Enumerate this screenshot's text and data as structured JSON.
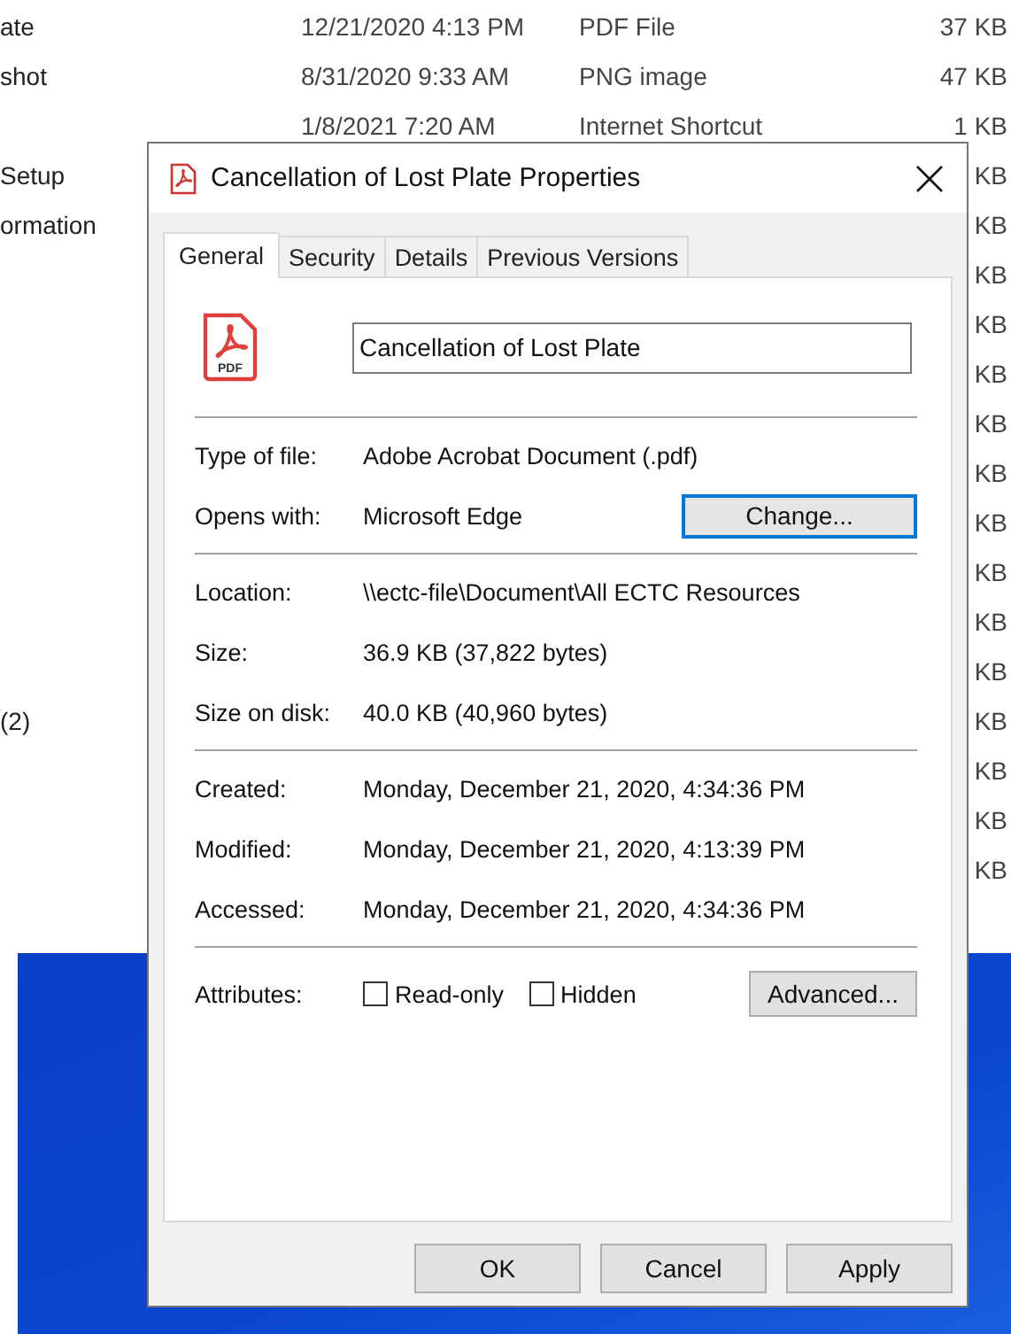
{
  "explorer": {
    "rows": [
      {
        "name": "ate",
        "date": "12/21/2020 4:13 PM",
        "type": "PDF File",
        "size": "37 KB"
      },
      {
        "name": "shot",
        "date": "8/31/2020 9:33 AM",
        "type": "PNG image",
        "size": "47 KB"
      },
      {
        "name": "",
        "date": "1/8/2021 7:20 AM",
        "type": "Internet Shortcut",
        "size": "1 KB"
      },
      {
        "name": "Setup",
        "date": "",
        "type": "",
        "size": "KB"
      },
      {
        "name": "ormation",
        "date": "",
        "type": "",
        "size": "KB"
      },
      {
        "name": "",
        "date": "",
        "type": "",
        "size": "KB"
      },
      {
        "name": "",
        "date": "",
        "type": "",
        "size": "KB"
      },
      {
        "name": "",
        "date": "",
        "type": "",
        "size": "KB"
      },
      {
        "name": "",
        "date": "",
        "type": "",
        "size": "KB"
      },
      {
        "name": "",
        "date": "",
        "type": "",
        "size": "KB"
      },
      {
        "name": "",
        "date": "",
        "type": "",
        "size": "KB"
      },
      {
        "name": "",
        "date": "",
        "type": "",
        "size": "KB"
      },
      {
        "name": "",
        "date": "",
        "type": "",
        "size": "KB"
      },
      {
        "name": "",
        "date": "",
        "type": "",
        "size": "KB"
      },
      {
        "name": "(2)",
        "date": "",
        "type": "",
        "size": "KB"
      },
      {
        "name": "",
        "date": "",
        "type": "",
        "size": "KB"
      },
      {
        "name": "",
        "date": "",
        "type": "",
        "size": "KB"
      },
      {
        "name": "",
        "date": "",
        "type": "",
        "size": "KB"
      }
    ]
  },
  "dialog": {
    "title": "Cancellation of Lost Plate Properties",
    "tabs": [
      {
        "label": "General",
        "selected": true
      },
      {
        "label": "Security",
        "selected": false
      },
      {
        "label": "Details",
        "selected": false
      },
      {
        "label": "Previous Versions",
        "selected": false
      }
    ],
    "file_name": "Cancellation of Lost Plate",
    "icon_label": "PDF",
    "sections": [
      [
        {
          "label": "Type of file:",
          "value": "Adobe Acrobat Document (.pdf)"
        },
        {
          "label": "Opens with:",
          "value": "Microsoft Edge",
          "button": "Change..."
        }
      ],
      [
        {
          "label": "Location:",
          "value": "\\\\ectc-file\\Document\\All ECTC Resources"
        },
        {
          "label": "Size:",
          "value": "36.9 KB (37,822 bytes)"
        },
        {
          "label": "Size on disk:",
          "value": "40.0 KB (40,960 bytes)"
        }
      ],
      [
        {
          "label": "Created:",
          "value": "Monday, December 21, 2020, 4:34:36 PM"
        },
        {
          "label": "Modified:",
          "value": "Monday, December 21, 2020, 4:13:39 PM"
        },
        {
          "label": "Accessed:",
          "value": "Monday, December 21, 2020, 4:34:36 PM"
        }
      ]
    ],
    "attributes": {
      "label": "Attributes:",
      "checkboxes": [
        {
          "label": "Read-only",
          "checked": false
        },
        {
          "label": "Hidden",
          "checked": false
        }
      ],
      "button": "Advanced..."
    },
    "buttons": [
      "OK",
      "Cancel",
      "Apply"
    ]
  }
}
